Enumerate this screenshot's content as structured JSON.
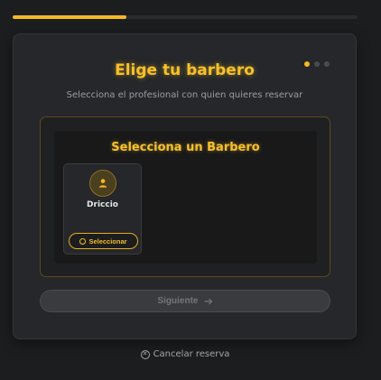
{
  "progress": {
    "value": 0.33,
    "color": "#f5b821"
  },
  "steps": {
    "total": 3,
    "current": 1
  },
  "header": {
    "title": "Elige tu barbero",
    "subtitle": "Selecciona el profesional con quien quieres reservar"
  },
  "selector": {
    "title": "Selecciona un Barbero",
    "barbers": [
      {
        "name": "Driccio",
        "avatar_icon": "user-icon",
        "select_label": "Seleccionar"
      }
    ]
  },
  "actions": {
    "next_label": "Siguiente",
    "next_icon": "arrow-right-icon",
    "next_disabled": true,
    "cancel_label": "Cancelar reserva",
    "cancel_icon": "close-circle-icon"
  },
  "colors": {
    "accent": "#f5b821",
    "background": "#1c1d1f",
    "card": "#25272a"
  }
}
